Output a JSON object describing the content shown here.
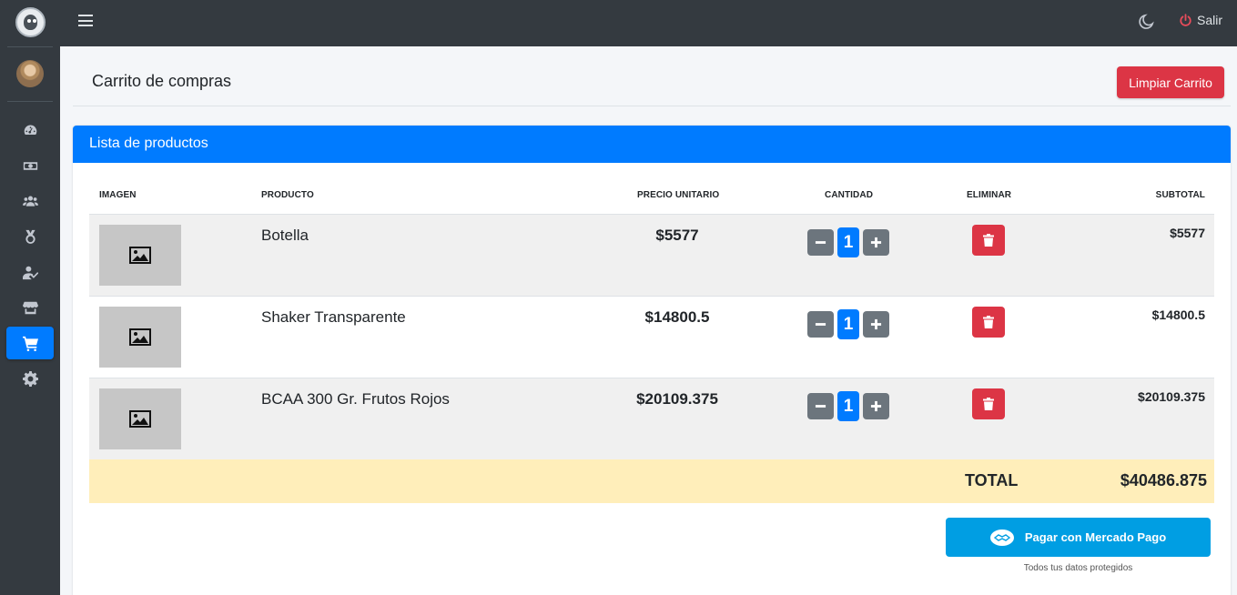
{
  "topbar": {
    "logout_label": "Salir"
  },
  "page": {
    "title": "Carrito de compras",
    "clear_label": "Limpiar Carrito"
  },
  "card": {
    "header": "Lista de productos"
  },
  "table": {
    "headers": [
      "IMAGEN",
      "PRODUCTO",
      "PRECIO UNITARIO",
      "CANTIDAD",
      "ELIMINAR",
      "SUBTOTAL"
    ],
    "rows": [
      {
        "name": "Botella",
        "price": "$5577",
        "qty": "1",
        "subtotal": "$5577"
      },
      {
        "name": "Shaker Transparente",
        "price": "$14800.5",
        "qty": "1",
        "subtotal": "$14800.5"
      },
      {
        "name": "BCAA 300 Gr. Frutos Rojos",
        "price": "$20109.375",
        "qty": "1",
        "subtotal": "$20109.375"
      }
    ],
    "total_label": "TOTAL",
    "total_value": "$40486.875"
  },
  "payment": {
    "button_label": "Pagar con Mercado Pago",
    "note": "Todos tus datos protegidos"
  },
  "sidebar": {
    "items": [
      {
        "icon": "dashboard-icon"
      },
      {
        "icon": "money-icon"
      },
      {
        "icon": "users-icon"
      },
      {
        "icon": "medal-icon"
      },
      {
        "icon": "user-check-icon"
      },
      {
        "icon": "store-icon"
      },
      {
        "icon": "cart-icon",
        "active": true
      },
      {
        "icon": "gear-icon"
      }
    ]
  },
  "colors": {
    "primary": "#007bff",
    "danger": "#dc3545",
    "secondary": "#6c757d",
    "dark": "#343a40",
    "total_bg": "#ffeeba",
    "mercadopago": "#009ee3"
  }
}
